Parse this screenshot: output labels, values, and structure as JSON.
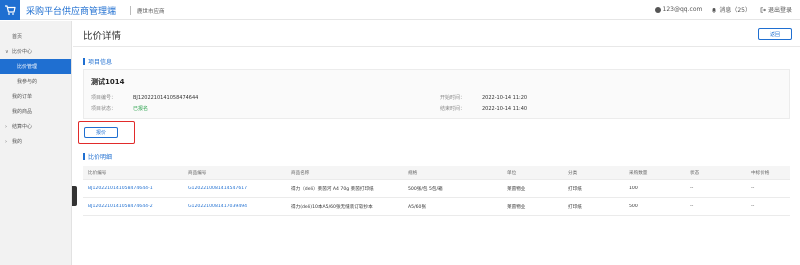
{
  "header": {
    "app_title": "采购平台供应商管理端",
    "company": "鹿世市应商",
    "email": "123@qq.com",
    "messages": "消息（25）",
    "logout": "退出登录"
  },
  "sidebar": {
    "items": [
      {
        "label": "首页",
        "kind": "item"
      },
      {
        "label": "比价中心",
        "kind": "group",
        "arrow": "∨"
      },
      {
        "label": "比价管理",
        "kind": "sub",
        "active": true
      },
      {
        "label": "我参与的",
        "kind": "sub"
      },
      {
        "label": "我的订单",
        "kind": "item"
      },
      {
        "label": "我的商品",
        "kind": "item"
      },
      {
        "label": "结算中心",
        "kind": "group",
        "arrow": "›"
      },
      {
        "label": "我的",
        "kind": "group",
        "arrow": "›"
      }
    ]
  },
  "page": {
    "title": "比价详情",
    "back_label": "返回"
  },
  "project_section": {
    "title": "项目信息",
    "name": "测试1014",
    "project_no_label": "项目编号：",
    "project_no": "BJ1202210141058474644",
    "status_label": "项目状态：",
    "status": "已报名",
    "start_label": "开始时间：",
    "start_time": "2022-10-14 11:20",
    "end_label": "结束时间：",
    "end_time": "2022-10-14 11:40"
  },
  "quote_button": "报价",
  "detail_section": {
    "title": "比价明细",
    "columns": [
      "比价编号",
      "商品编号",
      "商品名称",
      "规格",
      "单位",
      "分类",
      "采购数量",
      "状态",
      "中标价格"
    ],
    "rows": [
      [
        "BJ1202210141058474644-1",
        "G1202210081414547617",
        "得力（deli）莱茵河 A4 70g 莱茵打印纸",
        "500张/包 5包/箱",
        "莱茵物业",
        "打印纸",
        "100",
        "--",
        "--"
      ],
      [
        "BJ1202210141058474644-2",
        "G1202210081417039494",
        "得力(deli)10本A5/60张无缝装订软抄本",
        "A5/60张",
        "莱茵物业",
        "打印纸",
        "500",
        "--",
        "--"
      ]
    ]
  },
  "colors": {
    "accent": "#1f6fd1",
    "highlight": "#e12b2b",
    "success": "#2ea44f"
  }
}
